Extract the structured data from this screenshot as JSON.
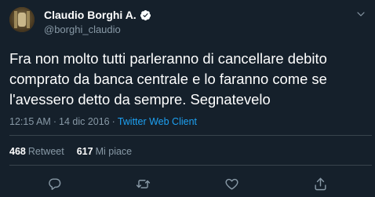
{
  "tweet": {
    "display_name": "Claudio Borghi A.",
    "handle": "@borghi_claudio",
    "text": "Fra non molto tutti parleranno di cancellare debito\ncomprato da banca centrale e lo faranno come se\nl'avessero detto da sempre. Segnatevelo",
    "time": "12:15 AM",
    "separator": "·",
    "date": "14 dic 2016",
    "client": "Twitter Web Client"
  },
  "stats": {
    "retweets_count": "468",
    "retweets_label": "Retweet",
    "likes_count": "617",
    "likes_label": "Mi piace"
  },
  "icons": {
    "verified": "verified-badge-icon",
    "more": "chevron-down-icon",
    "reply": "reply-icon",
    "retweet": "retweet-icon",
    "like": "heart-icon",
    "share": "share-icon"
  },
  "colors": {
    "background": "#15202b",
    "text": "#ffffff",
    "secondary": "#8899a6",
    "accent": "#1da1f2",
    "divider": "#38444d"
  }
}
